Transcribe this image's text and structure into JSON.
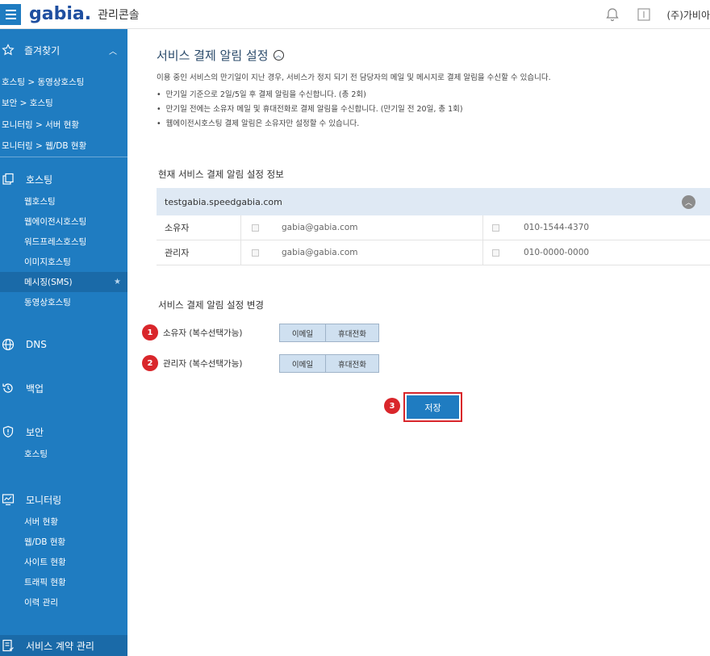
{
  "header": {
    "logo": "gabia.",
    "app_title": "관리콘솔",
    "company": "(주)가비아"
  },
  "sidebar": {
    "favorites_label": "즐겨찾기",
    "favorites": [
      "호스팅 > 동영상호스팅",
      "보안 > 호스팅",
      "모니터링 > 서버 현황",
      "모니터링 > 웹/DB 현황"
    ],
    "hosting": {
      "label": "호스팅",
      "items": [
        "웹호스팅",
        "웹에이전시호스팅",
        "워드프레스호스팅",
        "이미지호스팅",
        "메시징(SMS)",
        "동영상호스팅"
      ]
    },
    "dns": "DNS",
    "backup": "백업",
    "security": {
      "label": "보안",
      "items": [
        "호스팅"
      ]
    },
    "monitoring": {
      "label": "모니터링",
      "items": [
        "서버 현황",
        "웹/DB 현황",
        "사이트 현황",
        "트래픽 현황",
        "이력 관리"
      ]
    },
    "contract": "서비스 계약 관리"
  },
  "main": {
    "title": "서비스 결제 알림 설정",
    "description": "이용 중인 서비스의 만기일이 지난 경우, 서비스가 정지 되기 전 담당자의 메일 및 메시지로 결제 알림을 수신할 수 있습니다.",
    "bullets": [
      "만기일 기준으로 2일/5일 후 결제 알림을 수신합니다. (총 2회)",
      "만기일 전에는 소유자 메일 및 휴대전화로 결제 알림을 수신합니다. (만기일 전 20일, 총 1회)",
      "웹에이전시호스팅 결제 알림은 소유자만 설정할 수 있습니다."
    ],
    "current_info_title": "현재 서비스 결제 알림 설정 정보",
    "domain": "testgabia.speedgabia.com",
    "rows": [
      {
        "label": "소유자",
        "email": "gabia@gabia.com",
        "phone": "010-1544-4370"
      },
      {
        "label": "관리자",
        "email": "gabia@gabia.com",
        "phone": "010-0000-0000"
      }
    ],
    "change_title": "서비스 결제 알림 설정 변경",
    "settings": [
      {
        "badge": "1",
        "label": "소유자 (복수선택가능)",
        "email_btn": "이메일",
        "phone_btn": "휴대전화"
      },
      {
        "badge": "2",
        "label": "관리자 (복수선택가능)",
        "email_btn": "이메일",
        "phone_btn": "휴대전화"
      }
    ],
    "save_badge": "3",
    "save_label": "저장"
  },
  "colors": {
    "sidebar": "#1f7cc1",
    "accent_red": "#d9262b",
    "table_head": "#dfe9f4"
  }
}
